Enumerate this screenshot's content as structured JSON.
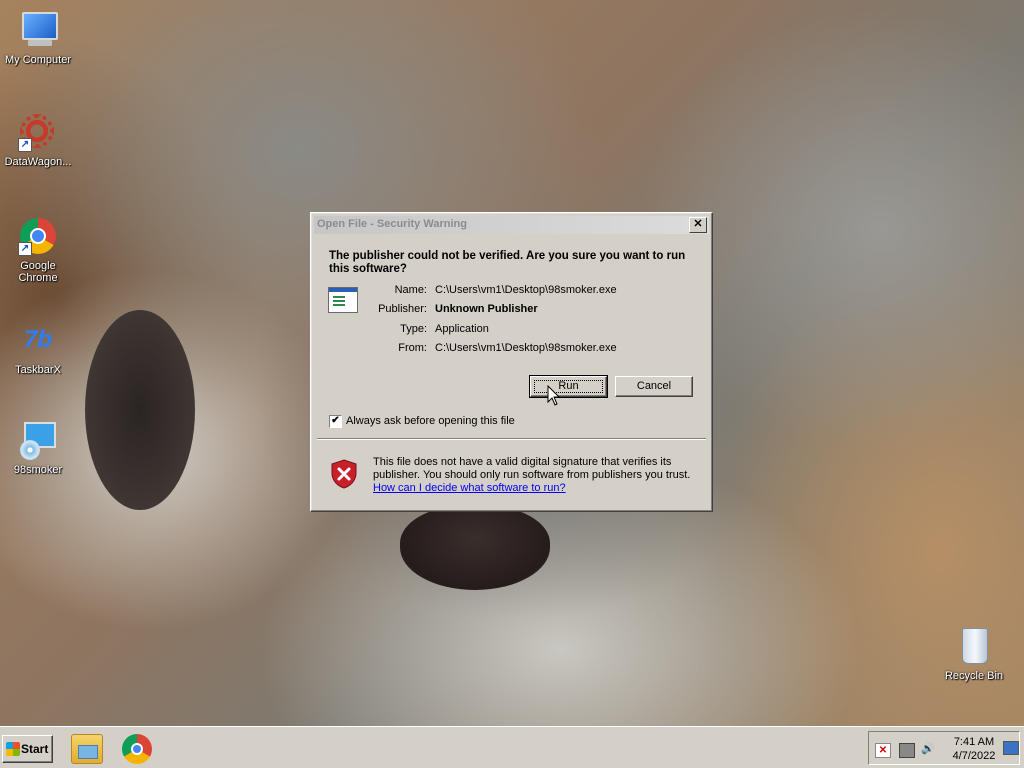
{
  "desktop": {
    "icons": [
      {
        "label": "My Computer",
        "icon": "computer-icon"
      },
      {
        "label": "DataWagon...",
        "icon": "gear-icon"
      },
      {
        "label": "Google Chrome",
        "icon": "chrome-icon"
      },
      {
        "label": "TaskbarX",
        "icon": "taskbarx-icon"
      },
      {
        "label": "98smoker",
        "icon": "installer-icon"
      },
      {
        "label": "Recycle Bin",
        "icon": "recycle-bin-icon"
      }
    ]
  },
  "dialog": {
    "title": "Open File - Security Warning",
    "heading": "The publisher could not be verified.  Are you sure you want to run this software?",
    "fields": [
      {
        "label": "Name:",
        "value": "C:\\Users\\vm1\\Desktop\\98smoker.exe"
      },
      {
        "label": "Publisher:",
        "value": "Unknown Publisher"
      },
      {
        "label": "Type:",
        "value": "Application"
      },
      {
        "label": "From:",
        "value": "C:\\Users\\vm1\\Desktop\\98smoker.exe"
      }
    ],
    "run_label": "Run",
    "cancel_label": "Cancel",
    "checkbox_label": "Always ask before opening this file",
    "checkbox_checked": true,
    "warning_text": "This file does not have a valid digital signature that verifies its publisher.  You should only run software from publishers you trust.",
    "warning_link": "How can I decide what software to run?"
  },
  "taskbar": {
    "start_label": "Start",
    "pinned": [
      {
        "icon": "explorer-folder-icon"
      },
      {
        "icon": "chrome-icon"
      }
    ],
    "clock_time": "7:41 AM",
    "clock_date": "4/7/2022"
  }
}
